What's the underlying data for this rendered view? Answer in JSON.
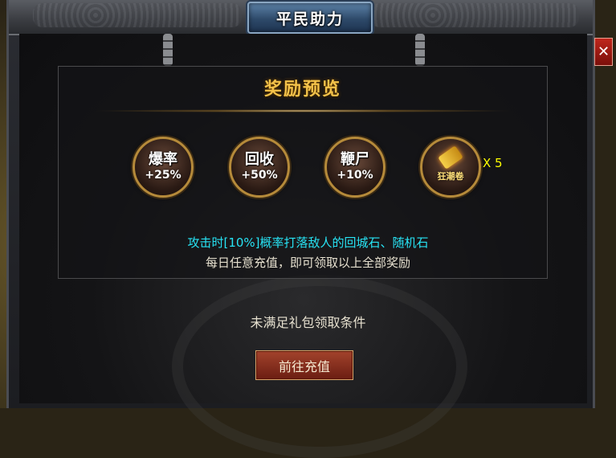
{
  "window": {
    "title": "平民助力",
    "close_symbol": "✕"
  },
  "panel": {
    "title": "奖励预览"
  },
  "rewards": [
    {
      "name": "爆率",
      "value": "+25%"
    },
    {
      "name": "回收",
      "value": "+50%"
    },
    {
      "name": "鞭尸",
      "value": "+10%"
    },
    {
      "name": "狂潮卷",
      "quantity": "X 5",
      "icon": "scroll-icon"
    }
  ],
  "description": {
    "line1": "攻击时[10%]概率打落敌人的回城石、随机石",
    "line2": "每日任意充值，即可领取以上全部奖励"
  },
  "status_text": "未满足礼包领取条件",
  "charge_button_label": "前往充值",
  "colors": {
    "title_gold": "#f3c24a",
    "cyan_text": "#27e3f4",
    "quantity_yellow": "#ffff00",
    "button_red": "#8c2a1c"
  }
}
